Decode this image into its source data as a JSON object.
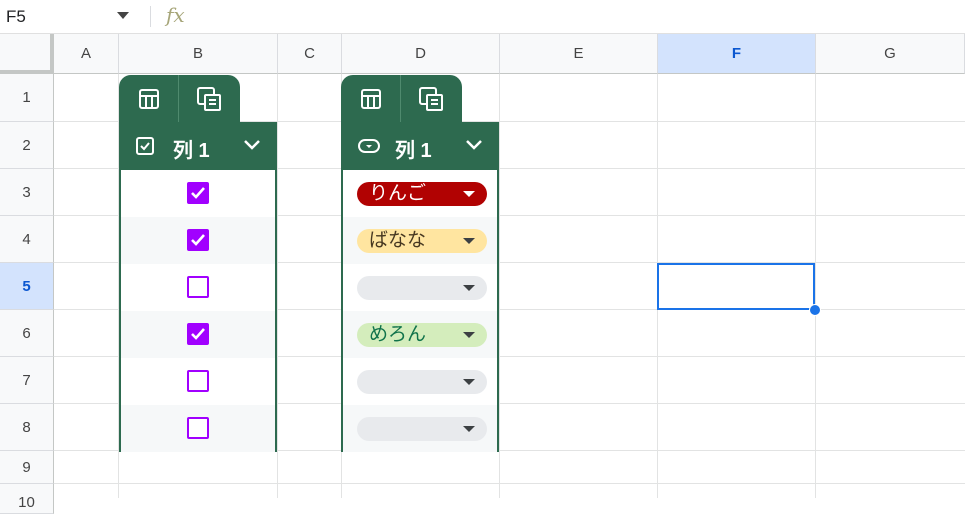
{
  "formula_bar": {
    "cell_ref": "F5",
    "fx_label": "fx",
    "formula": ""
  },
  "columns": [
    "A",
    "B",
    "C",
    "D",
    "E",
    "F",
    "G"
  ],
  "rows": [
    "1",
    "2",
    "3",
    "4",
    "5",
    "6",
    "7",
    "8",
    "9",
    "10"
  ],
  "selected": {
    "column": "F",
    "row": "5"
  },
  "table_checkbox": {
    "header_label": "列 1",
    "type_icon": "checkbox-icon",
    "values": [
      true,
      true,
      false,
      true,
      false,
      false
    ]
  },
  "table_dropdown": {
    "header_label": "列 1",
    "type_icon": "dropdown-chip-icon",
    "items": [
      {
        "label": "りんご",
        "bg": "#b10202",
        "fg": "#ffffff"
      },
      {
        "label": "ばなな",
        "bg": "#ffe5a0",
        "fg": "#473821"
      },
      {
        "label": "",
        "bg": "#e8eaed",
        "fg": "#3c4043"
      },
      {
        "label": "めろん",
        "bg": "#d4edbc",
        "fg": "#11734b"
      },
      {
        "label": "",
        "bg": "#e8eaed",
        "fg": "#3c4043"
      },
      {
        "label": "",
        "bg": "#e8eaed",
        "fg": "#3c4043"
      }
    ]
  },
  "colors": {
    "table_header": "#2d6a4f",
    "checkbox": "#a100ff",
    "selection": "#1a73e8"
  }
}
